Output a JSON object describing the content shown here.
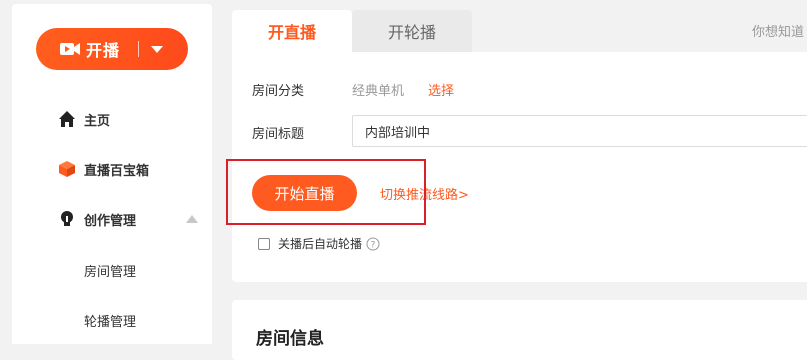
{
  "sidebar": {
    "live_button": {
      "label": "开播",
      "icon": "video-camera-icon",
      "dropdown_icon": "caret-down-icon"
    },
    "items": [
      {
        "label": "主页",
        "icon": "home-icon"
      },
      {
        "label": "直播百宝箱",
        "icon": "box-icon"
      },
      {
        "label": "创作管理",
        "icon": "lightbulb-icon",
        "expand_icon": "triangle-up-icon"
      }
    ],
    "sub_items": [
      {
        "label": "房间管理"
      },
      {
        "label": "轮播管理"
      }
    ]
  },
  "tabs": [
    {
      "label": "开直播",
      "active": true
    },
    {
      "label": "开轮播",
      "active": false
    }
  ],
  "hint_text": "你想知道",
  "form": {
    "category_label": "房间分类",
    "category_value": "经典单机",
    "category_link": "选择",
    "title_label": "房间标题",
    "title_value": "内部培训中",
    "start_button": "开始直播",
    "switch_link": "切换推流线路>",
    "auto_carousel_label": "关播后自动轮播",
    "help_icon": "question-circle-icon"
  },
  "info_card": {
    "title": "房间信息"
  },
  "colors": {
    "accent": "#ff5a1f",
    "highlight": "#d9202a"
  }
}
